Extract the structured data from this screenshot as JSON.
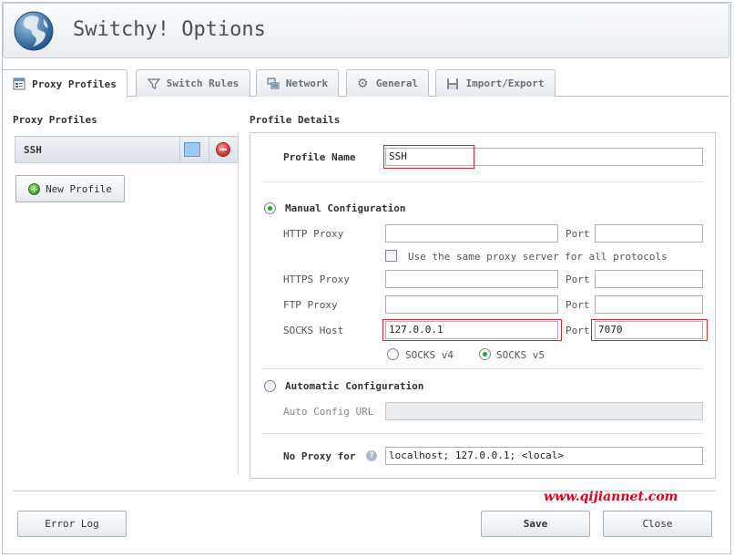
{
  "app": {
    "title": "Switchy! Options"
  },
  "tabs": [
    {
      "label": "Proxy Profiles",
      "icon": "proxy-profiles-icon"
    },
    {
      "label": "Switch Rules",
      "icon": "filter-icon"
    },
    {
      "label": "Network",
      "icon": "network-icon"
    },
    {
      "label": "General",
      "icon": "gear-icon"
    },
    {
      "label": "Import/Export",
      "icon": "floppy-disk-icon"
    }
  ],
  "left": {
    "heading": "Proxy Profiles",
    "profiles": [
      {
        "name": "SSH",
        "color": "#9ccaee"
      }
    ],
    "new_profile_label": "New Profile"
  },
  "details": {
    "heading": "Profile Details",
    "profile_name_label": "Profile Name",
    "profile_name_value": "SSH",
    "manual_label": "Manual Configuration",
    "http_label": "HTTP Proxy",
    "http_value": "",
    "port_label": "Port",
    "http_port": "",
    "same_proxy_label": "Use the same proxy server for all protocols",
    "https_label": "HTTPS Proxy",
    "https_value": "",
    "https_port": "",
    "ftp_label": "FTP Proxy",
    "ftp_value": "",
    "ftp_port": "",
    "socks_label": "SOCKS Host",
    "socks_value": "127.0.0.1",
    "socks_port": "7070",
    "socks_v4_label": "SOCKS v4",
    "socks_v5_label": "SOCKS v5",
    "auto_label": "Automatic Configuration",
    "auto_url_label": "Auto Config URL",
    "auto_url_value": "",
    "no_proxy_label": "No Proxy for",
    "no_proxy_value": "localhost; 127.0.0.1; <local>"
  },
  "footer": {
    "error_log_label": "Error Log",
    "save_label": "Save",
    "close_label": "Close",
    "watermark": "www.qijiannet.com"
  },
  "colors": {
    "highlight": "#d9262c",
    "selected_radio": "#2fa12a"
  }
}
